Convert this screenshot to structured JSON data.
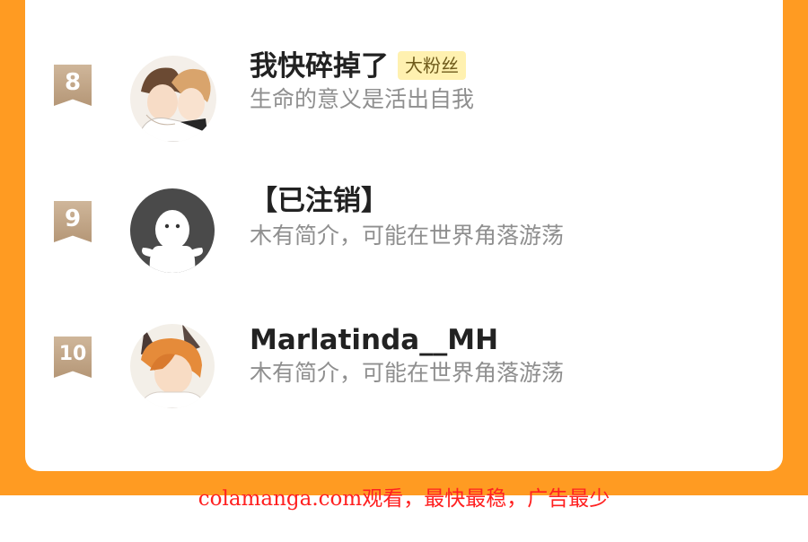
{
  "colors": {
    "frame": "#ff9b22",
    "card": "#ffffff",
    "name": "#222222",
    "bio": "#8f8f8f",
    "badge_bg": "#fff1b0",
    "rank_badge": "#c4a888",
    "watermark": "#ff2020"
  },
  "fans": [
    {
      "rank": "8",
      "name": "我快碎掉了",
      "badge": "大粉丝",
      "bio": "生命的意义是活出自我",
      "avatar_icon": "anime-couple-avatar"
    },
    {
      "rank": "9",
      "name": "【已注销】",
      "bio": "木有简介，可能在世界角落游荡",
      "avatar_icon": "default-ghost-avatar"
    },
    {
      "rank": "10",
      "name": "Marlatinda__MH",
      "bio": "木有简介，可能在世界角落游荡",
      "avatar_icon": "anime-foxboy-avatar"
    }
  ],
  "watermark": "colamanga.com观看，最快最稳，广告最少"
}
